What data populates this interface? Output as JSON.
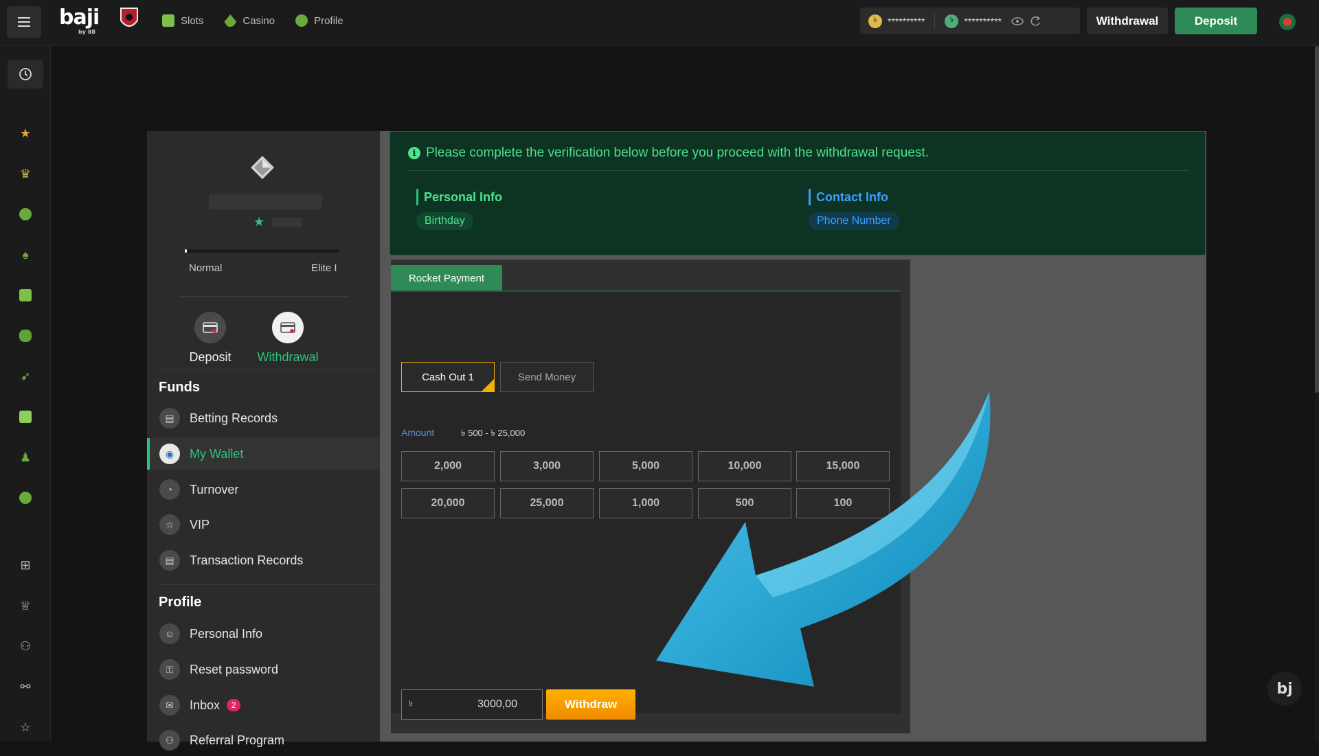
{
  "header": {
    "logo": "baji",
    "logo_sub": "by 88",
    "nav": [
      {
        "label": "Slots",
        "icon": "slots-icon"
      },
      {
        "label": "Casino",
        "icon": "casino-icon"
      },
      {
        "label": "Profile",
        "icon": "profile-icon"
      }
    ],
    "balance_main": "**********",
    "balance_bonus": "**********",
    "withdrawal_label": "Withdrawal",
    "deposit_label": "Deposit"
  },
  "account": {
    "level_from": "Normal",
    "level_to": "Elite I",
    "progress": 0.01,
    "deposit_label": "Deposit",
    "withdrawal_label": "Withdrawal",
    "funds_title": "Funds",
    "funds_items": [
      "Betting Records",
      "My Wallet",
      "Turnover",
      "VIP",
      "Transaction Records"
    ],
    "active_item": "My Wallet",
    "profile_title": "Profile",
    "profile_items": [
      "Personal Info",
      "Reset password",
      "Inbox",
      "Referral Program"
    ],
    "inbox_count": "2"
  },
  "verification": {
    "message": "Please complete the verification below before you proceed with the withdrawal request.",
    "personal_title": "Personal Info",
    "personal_chip": "Birthday",
    "contact_title": "Contact Info",
    "contact_chip": "Phone Number"
  },
  "payment": {
    "tab": "Rocket Payment",
    "options": [
      "Cash Out 1",
      "Send Money"
    ],
    "selected_option": "Cash Out 1",
    "amount_label": "Amount",
    "amount_range": "৳ 500 - ৳ 25,000",
    "amounts": [
      "2,000",
      "3,000",
      "5,000",
      "10,000",
      "15,000",
      "20,000",
      "25,000",
      "1,000",
      "500",
      "100"
    ],
    "currency": "৳",
    "input_value": "3000,00",
    "withdraw_label": "Withdraw"
  },
  "colors": {
    "accent_green": "#2e8b57",
    "active_green": "#2ec27e",
    "withdraw_orange": "#f5a000",
    "contact_blue": "#3aa0ff"
  },
  "floating": {
    "label": "bj"
  }
}
